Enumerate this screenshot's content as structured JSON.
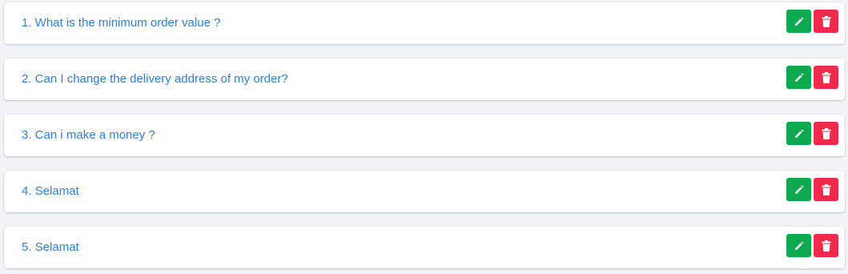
{
  "faq": {
    "items": [
      {
        "question": "1. What is the minimum order value ?"
      },
      {
        "question": "2. Can I change the delivery address of my order?"
      },
      {
        "question": "3. Can i make a money ?"
      },
      {
        "question": "4. Selamat"
      },
      {
        "question": "5. Selamat"
      }
    ],
    "edit_icon": "pencil-icon",
    "delete_icon": "trash-icon"
  },
  "colors": {
    "question_text": "#2e7fd6",
    "edit_button": "#0ea84e",
    "delete_button": "#ef2a4a",
    "background": "#f3f4f7"
  }
}
